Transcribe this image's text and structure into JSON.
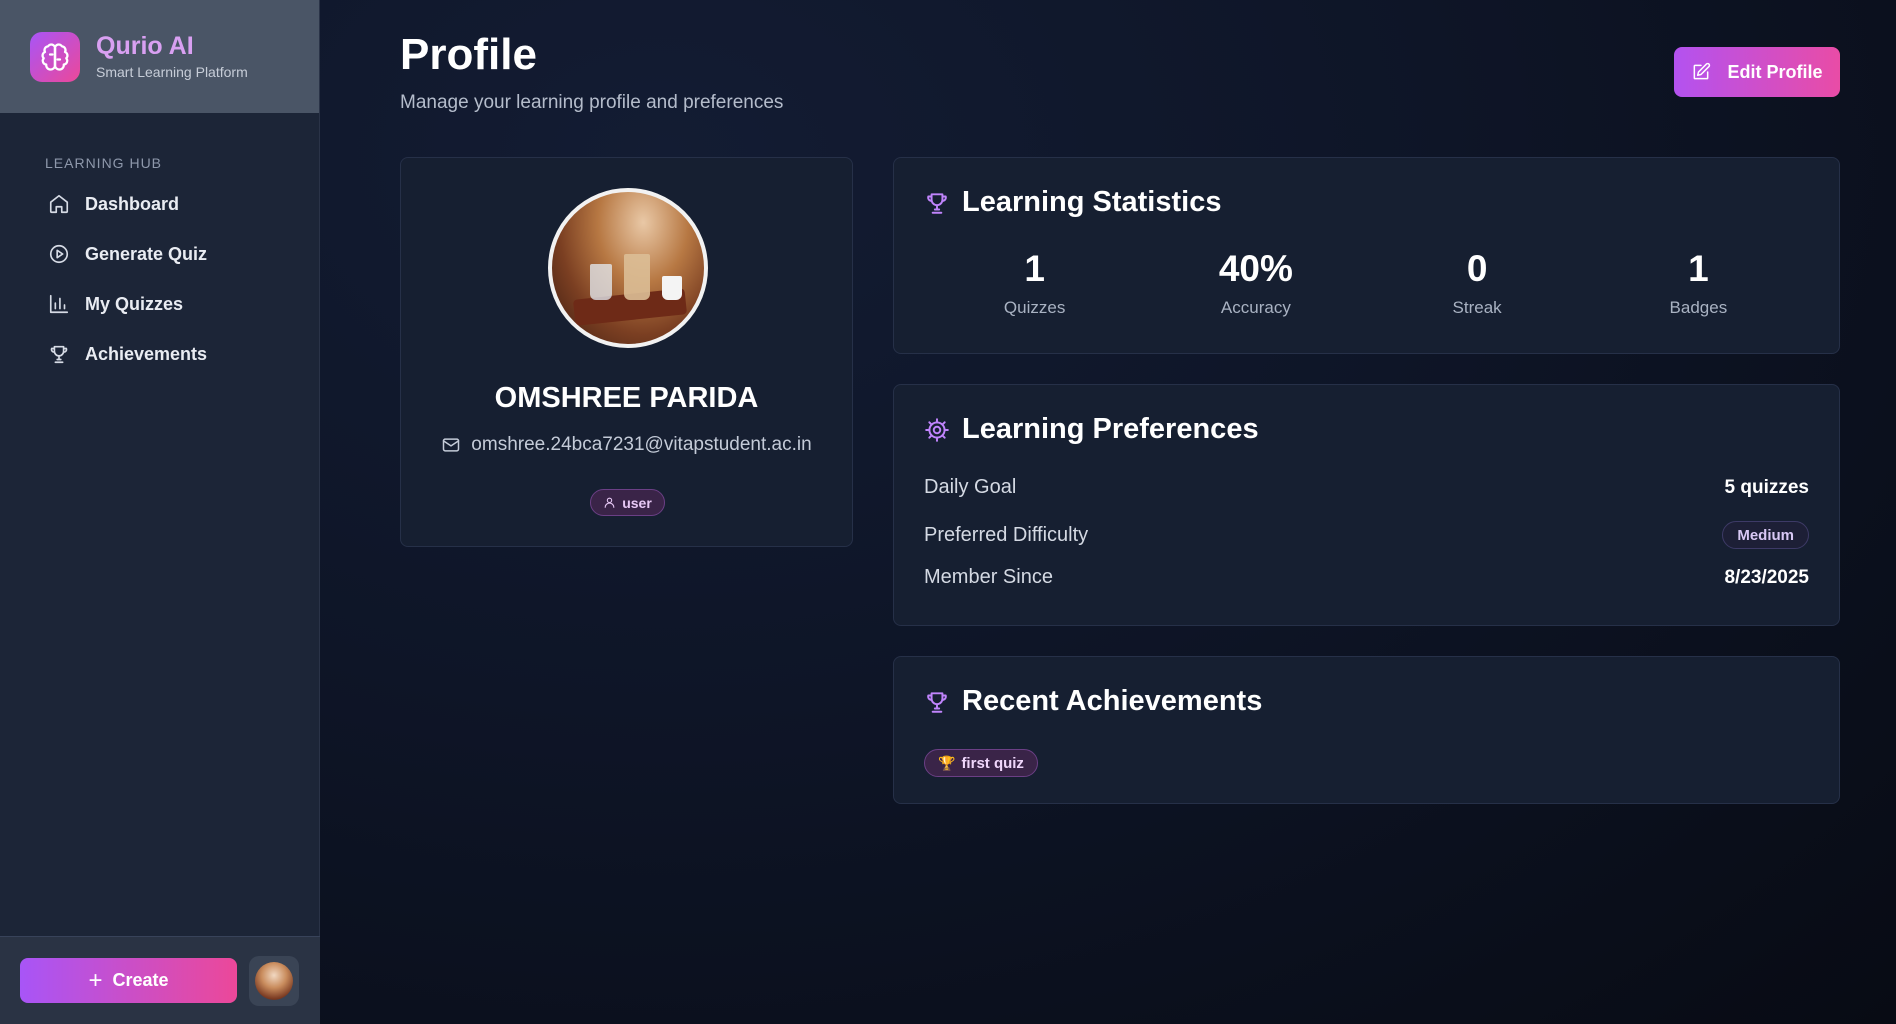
{
  "brand": {
    "name": "Qurio AI",
    "subtitle": "Smart Learning Platform"
  },
  "sidebar": {
    "section_label": "LEARNING HUB",
    "items": [
      {
        "label": "Dashboard",
        "icon": "home-icon"
      },
      {
        "label": "Generate Quiz",
        "icon": "play-circle-icon"
      },
      {
        "label": "My Quizzes",
        "icon": "bar-chart-icon"
      },
      {
        "label": "Achievements",
        "icon": "trophy-icon"
      }
    ],
    "create_label": "Create"
  },
  "header": {
    "title": "Profile",
    "subtitle": "Manage your learning profile and preferences",
    "edit_label": "Edit Profile"
  },
  "profile": {
    "name": "OMSHREE PARIDA",
    "email": "omshree.24bca7231@vitapstudent.ac.in",
    "role": "user"
  },
  "stats": {
    "title": "Learning Statistics",
    "items": [
      {
        "value": "1",
        "label": "Quizzes"
      },
      {
        "value": "40%",
        "label": "Accuracy"
      },
      {
        "value": "0",
        "label": "Streak"
      },
      {
        "value": "1",
        "label": "Badges"
      }
    ]
  },
  "preferences": {
    "title": "Learning Preferences",
    "daily_goal_label": "Daily Goal",
    "daily_goal_value": "5 quizzes",
    "difficulty_label": "Preferred Difficulty",
    "difficulty_value": "Medium",
    "member_since_label": "Member Since",
    "member_since_value": "8/23/2025"
  },
  "achievements": {
    "title": "Recent Achievements",
    "badges": [
      "first quiz"
    ]
  },
  "colors": {
    "accent_start": "#a855f7",
    "accent_end": "#ec4899",
    "background": "#0e1527",
    "card": "#161f31"
  }
}
